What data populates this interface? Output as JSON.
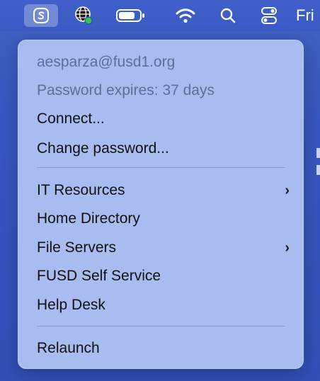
{
  "menubar": {
    "clock_text": "Fri",
    "items": [
      {
        "icon": "self-service-app-icon",
        "selected": true
      },
      {
        "icon": "network-globe-icon"
      },
      {
        "icon": "battery-icon"
      },
      {
        "icon": "wifi-icon"
      },
      {
        "icon": "search-icon"
      },
      {
        "icon": "control-center-icon"
      }
    ],
    "status_dot_color": "#3cc24a"
  },
  "menu": {
    "account_email": "aesparza@fusd1.org",
    "password_status": "Password expires: 37 days",
    "connect_label": "Connect...",
    "change_password_label": "Change password...",
    "it_resources_label": "IT Resources",
    "home_directory_label": "Home Directory",
    "file_servers_label": "File Servers",
    "self_service_label": "FUSD Self Service",
    "help_desk_label": "Help Desk",
    "relaunch_label": "Relaunch",
    "submenu_chevron": "›"
  },
  "colors": {
    "menu_background": "#a9bcf0",
    "menubar_background": "#3a5bc4",
    "disabled_text": "#5f6d96"
  }
}
